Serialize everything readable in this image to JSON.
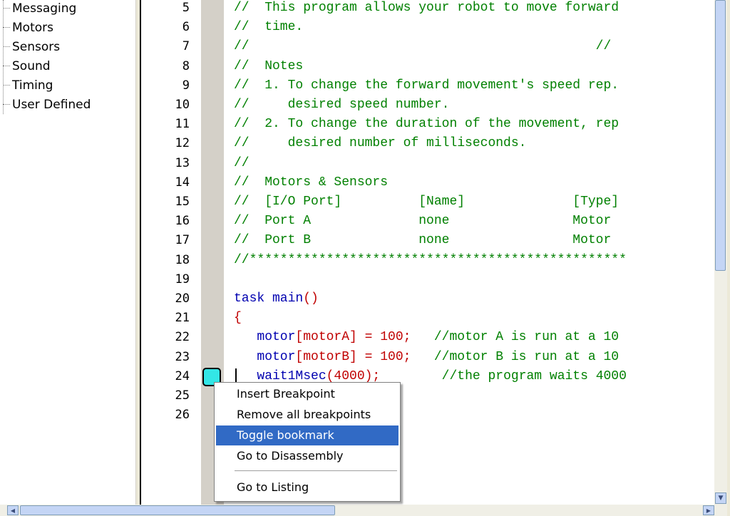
{
  "tree": {
    "items": [
      "Messaging",
      "Motors",
      "Sensors",
      "Sound",
      "Timing",
      "User Defined"
    ]
  },
  "editor": {
    "line_numbers": [
      "5",
      "6",
      "7",
      "8",
      "9",
      "10",
      "11",
      "12",
      "13",
      "14",
      "15",
      "16",
      "17",
      "18",
      "19",
      "20",
      "21",
      "22",
      "23",
      "24",
      "25",
      "26"
    ],
    "lines": [
      [
        {
          "c": "cmt",
          "t": "//  This program allows your robot to move forward"
        }
      ],
      [
        {
          "c": "cmt",
          "t": "//  time."
        }
      ],
      [
        {
          "c": "cmt",
          "t": "//                                             //"
        }
      ],
      [
        {
          "c": "cmt",
          "t": "//  Notes"
        }
      ],
      [
        {
          "c": "cmt",
          "t": "//  1. To change the forward movement's speed rep."
        }
      ],
      [
        {
          "c": "cmt",
          "t": "//     desired speed number."
        }
      ],
      [
        {
          "c": "cmt",
          "t": "//  2. To change the duration of the movement, rep"
        }
      ],
      [
        {
          "c": "cmt",
          "t": "//     desired number of milliseconds."
        }
      ],
      [
        {
          "c": "cmt",
          "t": "//"
        }
      ],
      [
        {
          "c": "cmt",
          "t": "//  Motors & Sensors"
        }
      ],
      [
        {
          "c": "cmt",
          "t": "//  [I/O Port]          [Name]              [Type]"
        }
      ],
      [
        {
          "c": "cmt",
          "t": "//  Port A              none                Motor"
        }
      ],
      [
        {
          "c": "cmt",
          "t": "//  Port B              none                Motor"
        }
      ],
      [
        {
          "c": "cmt",
          "t": "//*************************************************"
        }
      ],
      [],
      [
        {
          "c": "kw",
          "t": "task main"
        },
        {
          "c": "red",
          "t": "()"
        }
      ],
      [
        {
          "c": "red",
          "t": "{"
        }
      ],
      [
        {
          "c": "blk",
          "t": "   "
        },
        {
          "c": "kw",
          "t": "motor"
        },
        {
          "c": "red",
          "t": "[motorA] = 100;"
        },
        {
          "c": "blk",
          "t": "   "
        },
        {
          "c": "cmt",
          "t": "//motor A is run at a 10"
        }
      ],
      [
        {
          "c": "blk",
          "t": "   "
        },
        {
          "c": "kw",
          "t": "motor"
        },
        {
          "c": "red",
          "t": "[motorB] = 100;"
        },
        {
          "c": "blk",
          "t": "   "
        },
        {
          "c": "cmt",
          "t": "//motor B is run at a 10"
        }
      ],
      [
        {
          "c": "blk",
          "t": "   "
        },
        {
          "c": "kw",
          "t": "wait1Msec"
        },
        {
          "c": "red",
          "t": "(4000);"
        },
        {
          "c": "blk",
          "t": "        "
        },
        {
          "c": "cmt",
          "t": "//the program waits 4000"
        }
      ],
      [],
      []
    ]
  },
  "context_menu": {
    "items": [
      "Insert Breakpoint",
      "Remove all breakpoints",
      "Toggle bookmark",
      "Go to Disassembly",
      "Go to Listing"
    ],
    "active_index": 2
  },
  "colors": {
    "comment": "#008000",
    "keyword": "#0000b0",
    "punctuation": "#c00000",
    "menu_highlight": "#316ac5",
    "bookmark": "#33e6e6"
  },
  "icons": {
    "scroll_down": "chevron-down-icon",
    "scroll_left": "chevron-left-icon",
    "scroll_right": "chevron-right-icon"
  }
}
